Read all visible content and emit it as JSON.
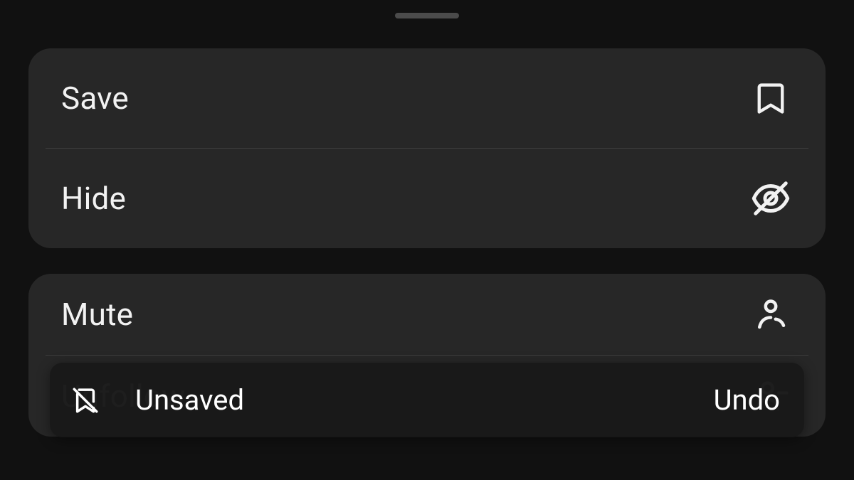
{
  "menu": {
    "group1": {
      "save_label": "Save",
      "hide_label": "Hide"
    },
    "group2": {
      "mute_label": "Mute",
      "unfollow_label": "Unfollow"
    }
  },
  "toast": {
    "message": "Unsaved",
    "action_label": "Undo"
  },
  "colors": {
    "background": "#111111",
    "panel": "#3a3a3a",
    "text": "#f2f2f2"
  }
}
